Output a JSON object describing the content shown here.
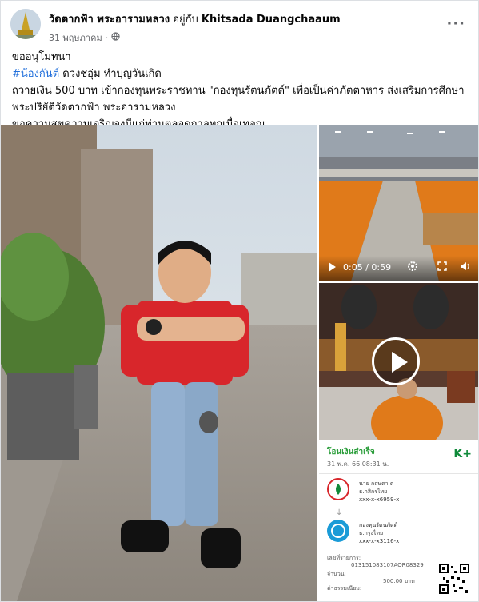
{
  "post": {
    "page_name": "วัดตากฟ้า พระอารามหลวง",
    "with_text": "อยู่กับ",
    "with_name": "Khitsada Duangchaaum",
    "date": "31 พฤษภาคม",
    "separator": "·",
    "more_label": "···",
    "privacy_icon": "globe-icon"
  },
  "body": {
    "line1": "ขออนุโมทนา",
    "hashtag": "#น้องกันต์",
    "line2_rest": " ดวงชอุ่ม ทำบุญวันเกิด",
    "line3": "  ถวายเงิน 500 บาท เข้ากองทุนพระราชทาน \"กองทุนรัตนภัตต์\" เพื่อเป็นค่าภัตตาหาร ส่งเสริมการศึกษา",
    "line4": "พระปริยัติวัดตากฟ้า พระอารามหลวง",
    "line5": "  ขอความสุขความเจริญจงมีแก่ท่านตลอดกาลทุกเมื่อเทอญ"
  },
  "media": {
    "video1_time": "0:05 / 0:59",
    "slip": {
      "title": "โอนเงินสำเร็จ",
      "date": "31 พ.ค. 66 08:31 น.",
      "logo": "K+",
      "from_name": "นาย กฤษดา ด",
      "from_bank": "ธ.กสิกรไทย",
      "from_acct": "xxx-x-x6959-x",
      "to_name": "กองทุนรัตนภัตต์",
      "to_bank": "ธ.กรุงไทย",
      "to_acct": "xxx-x-x3116-x",
      "ref_label": "เลขที่รายการ:",
      "ref_value": "013151083107AOR08329",
      "amount_label": "จำนวน:",
      "amount_value": "500.00 บาท",
      "fee_label": "ค่าธรรมเนียม:"
    }
  },
  "colors": {
    "hashtag": "#216fdb",
    "kbank_green": "#0f8a3a",
    "robe": "#e07a1a",
    "shirt": "#d8262b"
  }
}
